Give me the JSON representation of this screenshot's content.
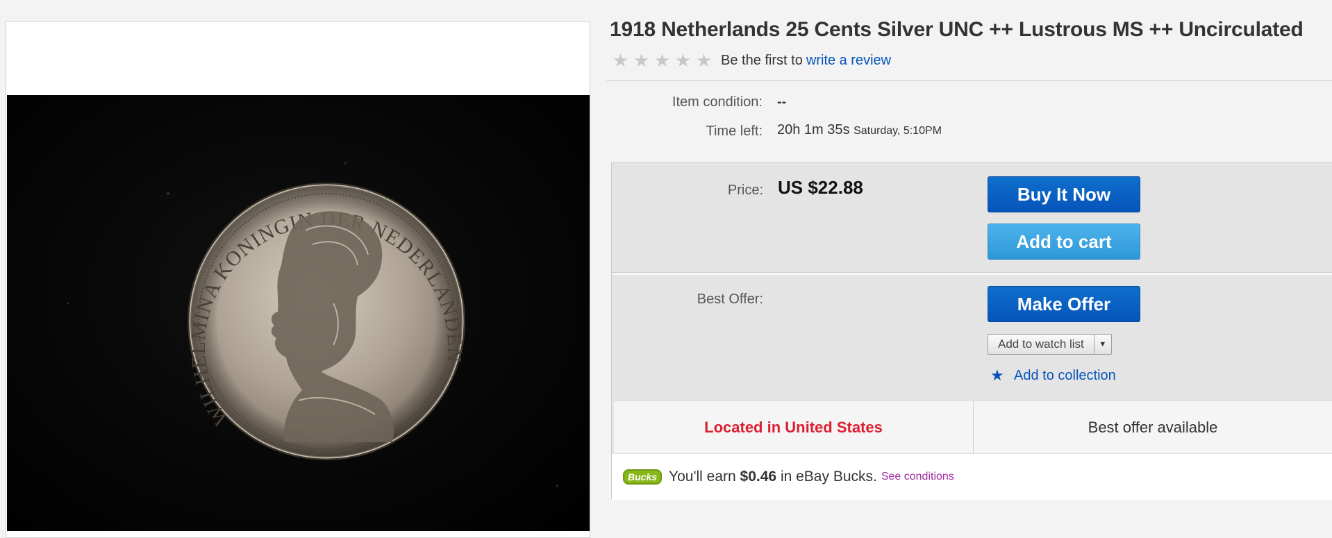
{
  "listing": {
    "title": "1918 Netherlands 25 Cents Silver UNC ++ Lustrous MS ++ Uncirculated",
    "rating": {
      "stars_filled": 0,
      "stars_total": 5,
      "prompt": "Be the first to",
      "link": "write a review"
    }
  },
  "details": {
    "condition_label": "Item condition:",
    "condition_value": "--",
    "time_left_label": "Time left:",
    "time_left_value": "20h 1m 35s",
    "time_left_end": "Saturday, 5:10PM"
  },
  "purchase": {
    "price_label": "Price:",
    "price_value": "US $22.88",
    "buy_now": "Buy It Now",
    "add_to_cart": "Add to cart",
    "best_offer_label": "Best Offer:",
    "make_offer": "Make Offer",
    "watch_list": "Add to watch list",
    "add_to_collection": "Add to collection",
    "located": "Located in United States",
    "best_offer_available": "Best offer available"
  },
  "bucks": {
    "badge": "Bucks",
    "earn_prefix": "You'll earn",
    "amount": "$0.46",
    "earn_suffix": "in eBay Bucks.",
    "link": "See conditions"
  },
  "colors": {
    "button_primary": "#0654ba",
    "button_secondary": "#2d97d6",
    "link": "#0654ba",
    "located_red": "#dd1e31",
    "bucks_green": "#86b817",
    "bucks_link": "#a02b9f"
  },
  "image": {
    "coin_legend": "WILHELMINA KONINGIN DER NEDERLANDEN"
  }
}
